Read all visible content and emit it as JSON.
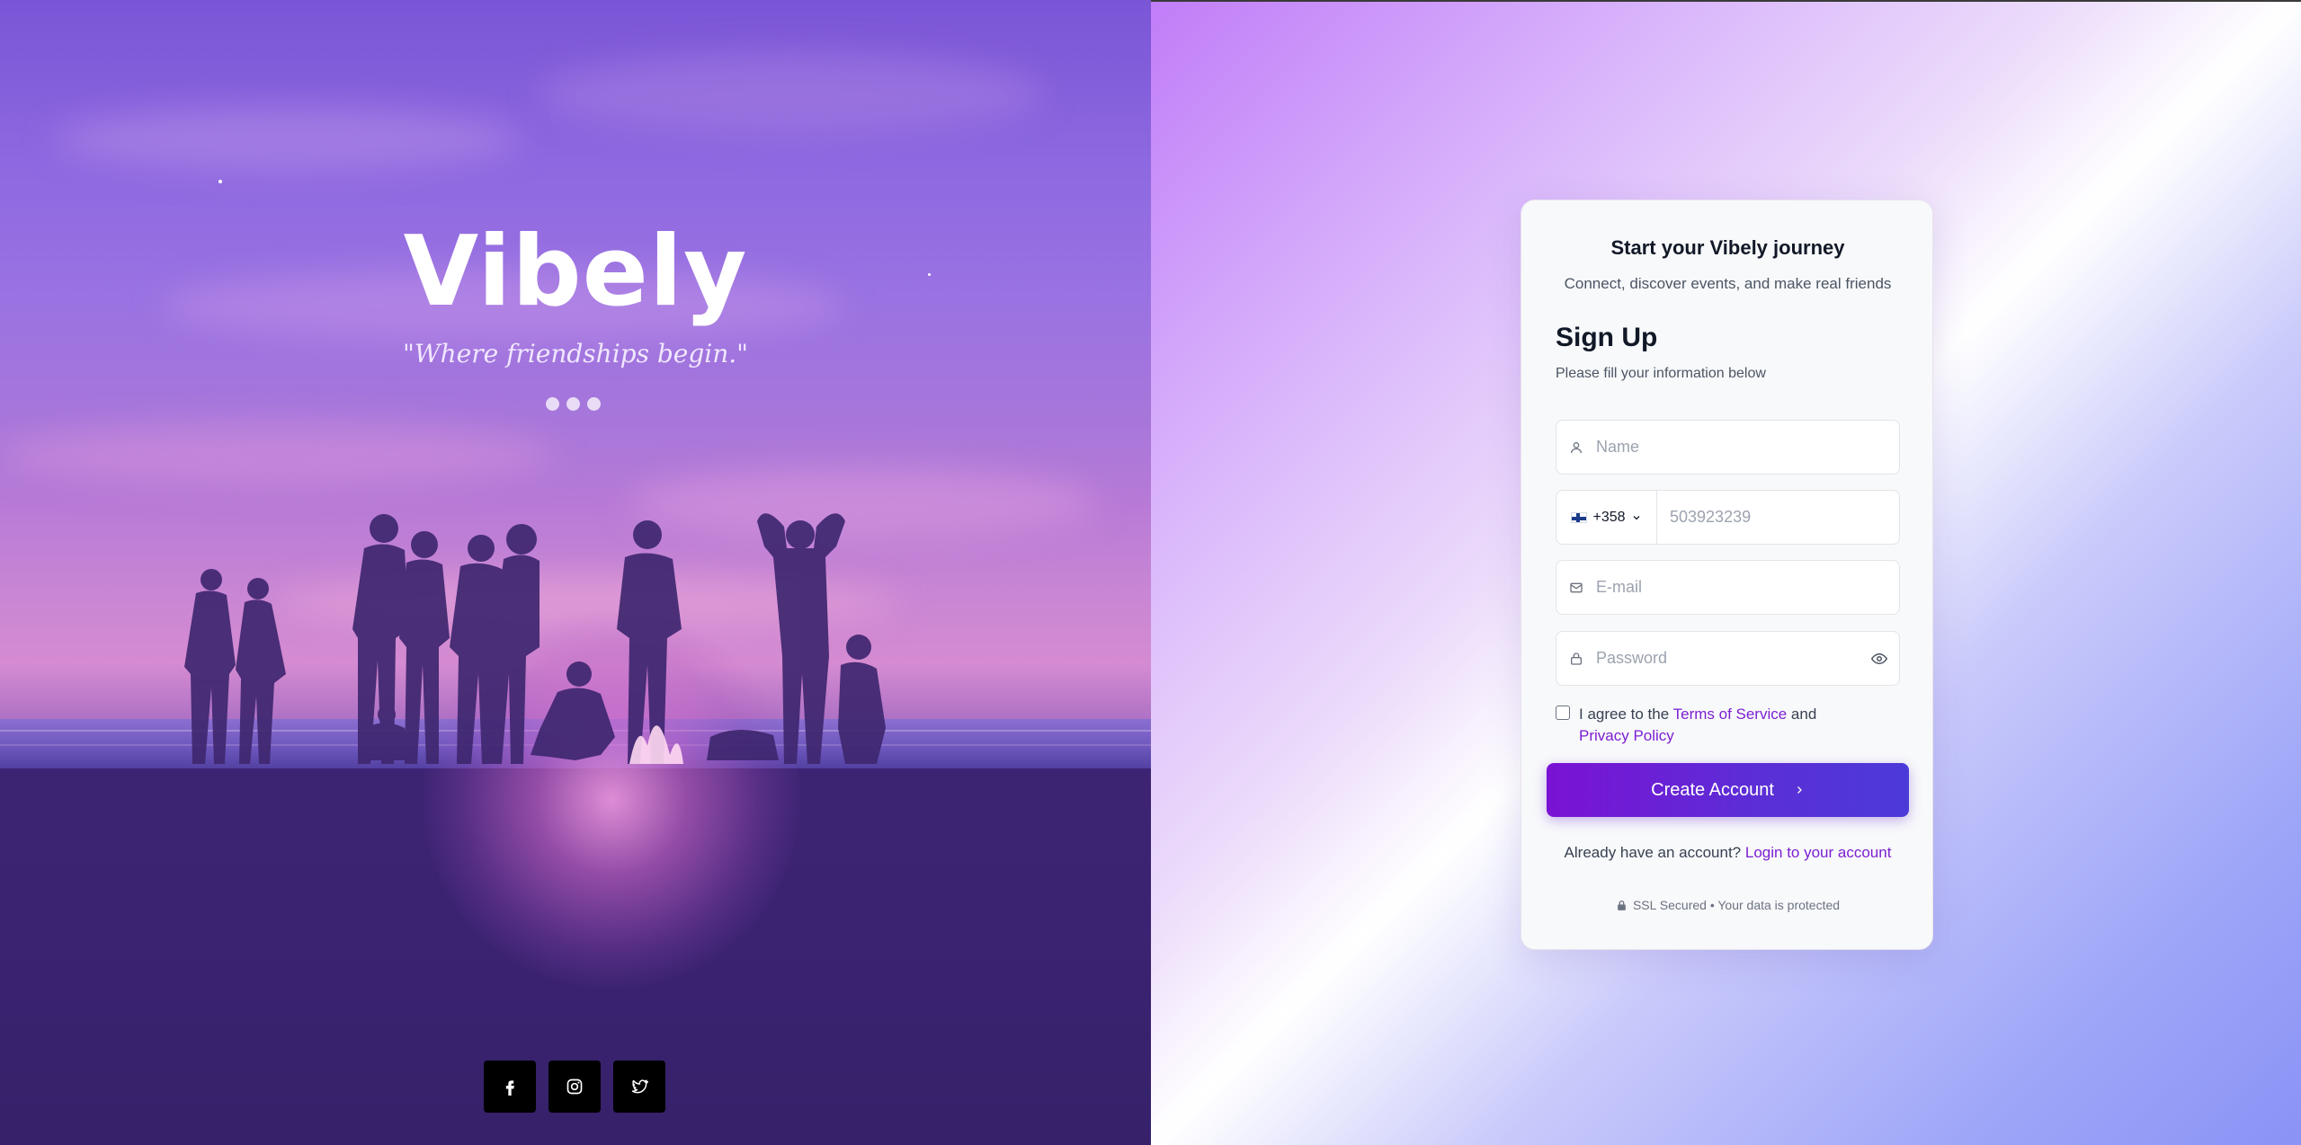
{
  "hero": {
    "brand": "Vibely",
    "tagline": "\"Where friendships begin.\"",
    "carousel_dots": 3,
    "social": [
      {
        "name": "facebook",
        "icon": "facebook-icon"
      },
      {
        "name": "instagram",
        "icon": "instagram-icon"
      },
      {
        "name": "twitter",
        "icon": "twitter-icon"
      }
    ]
  },
  "card": {
    "header_title": "Start your Vibely journey",
    "header_subtitle": "Connect, discover events, and make real friends",
    "form_title": "Sign Up",
    "form_subtitle": "Please fill your information below",
    "fields": {
      "name": {
        "placeholder": "Name",
        "value": ""
      },
      "phone": {
        "country_code": "+358",
        "country": "Finland",
        "placeholder": "503923239",
        "value": ""
      },
      "email": {
        "placeholder": "E-mail",
        "value": ""
      },
      "password": {
        "placeholder": "Password",
        "value": ""
      }
    },
    "terms": {
      "checked": false,
      "prefix": "I agree to the ",
      "terms_link": "Terms of Service",
      "conjunction": " and",
      "privacy_link": "Privacy Policy"
    },
    "submit_label": "Create Account",
    "login_prompt": "Already have an account?",
    "login_link": "Login to your account",
    "ssl_text": "SSL Secured • Your data is protected"
  },
  "colors": {
    "accent": "#7c1fd1",
    "button_start": "#7a12d4",
    "button_end": "#4c3ad8"
  }
}
